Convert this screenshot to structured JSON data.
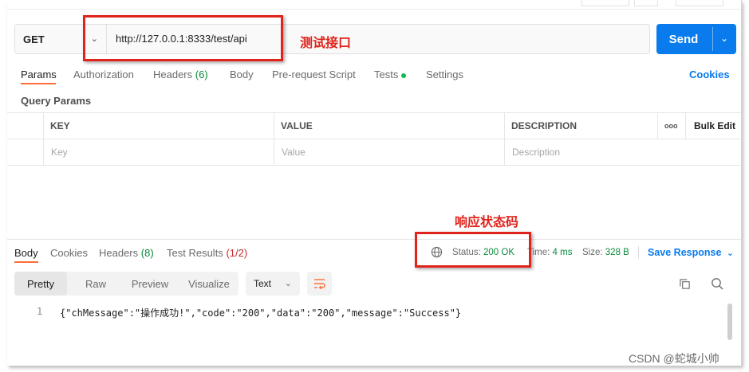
{
  "request": {
    "method": "GET",
    "url": "http://127.0.0.1:8333/test/api",
    "send_label": "Send"
  },
  "annotations": {
    "url_note": "测试接口",
    "status_note": "响应状态码"
  },
  "request_tabs": [
    {
      "label": "Params",
      "count": ""
    },
    {
      "label": "Authorization",
      "count": ""
    },
    {
      "label": "Headers",
      "count": "(6)"
    },
    {
      "label": "Body",
      "count": ""
    },
    {
      "label": "Pre-request Script",
      "count": ""
    },
    {
      "label": "Tests",
      "count": ""
    },
    {
      "label": "Settings",
      "count": ""
    }
  ],
  "cookies_link": "Cookies",
  "query_params": {
    "title": "Query Params",
    "headers": {
      "key": "KEY",
      "value": "VALUE",
      "description": "DESCRIPTION",
      "bulk_edit": "Bulk Edit",
      "more": "ooo"
    },
    "placeholders": {
      "key": "Key",
      "value": "Value",
      "description": "Description"
    }
  },
  "response_tabs": [
    {
      "label": "Body",
      "count": ""
    },
    {
      "label": "Cookies",
      "count": ""
    },
    {
      "label": "Headers",
      "count": "(8)"
    },
    {
      "label": "Test Results",
      "count": "(1/2)"
    }
  ],
  "response_status": {
    "status_label": "Status:",
    "status_value": "200 OK",
    "time_label": "Time:",
    "time_value": "4 ms",
    "size_label": "Size:",
    "size_value": "328 B",
    "save_label": "Save Response"
  },
  "format_tabs": [
    "Pretty",
    "Raw",
    "Preview",
    "Visualize"
  ],
  "format_selected": "Text",
  "response_body": {
    "line_number": "1",
    "text": "{\"chMessage\":\"操作成功!\",\"code\":\"200\",\"data\":\"200\",\"message\":\"Success\"}"
  },
  "watermark": "CSDN @蛇城小帅",
  "colors": {
    "accent": "#097bed",
    "active_tab": "#ff6c37",
    "annotation": "#e0231b",
    "success": "#0a8a3a"
  }
}
